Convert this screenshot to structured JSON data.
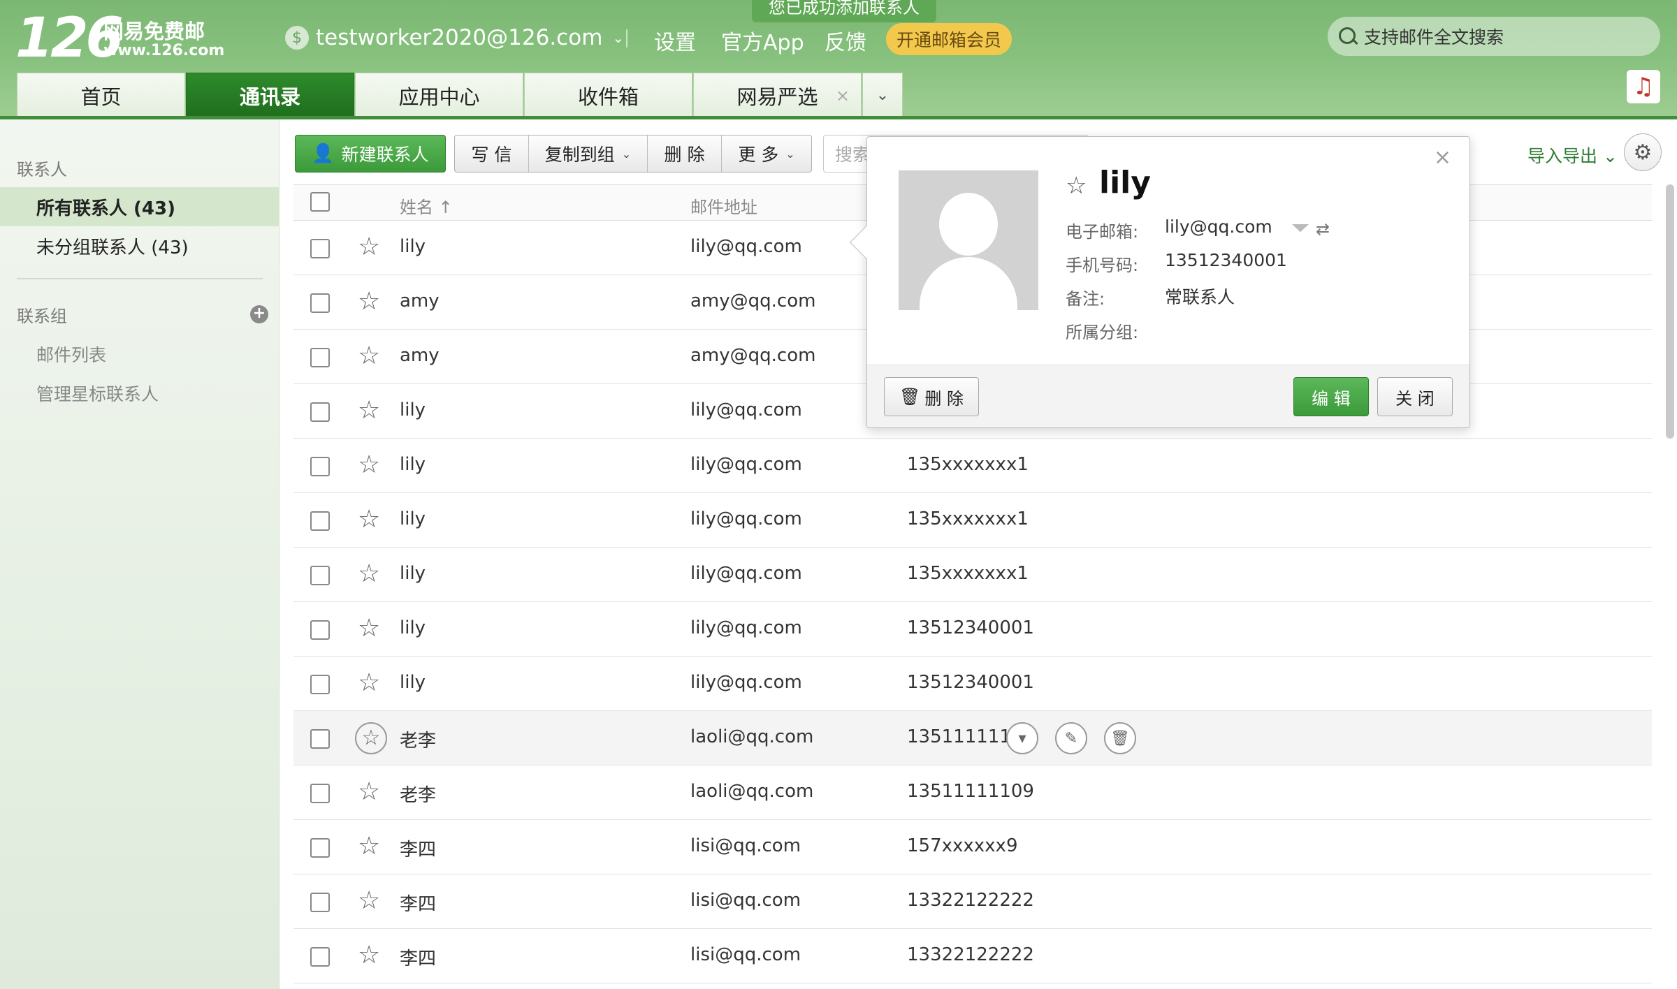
{
  "brand": {
    "logo_number": "126",
    "name": "网易免费邮",
    "url": "www.126.com"
  },
  "header": {
    "account": "testworker2020@126.com",
    "links": [
      "设置",
      "官方App",
      "反馈"
    ],
    "vip_button": "开通邮箱会员",
    "toast": "您已成功添加联系人",
    "search_placeholder": "支持邮件全文搜索"
  },
  "tabs": [
    {
      "label": "首页"
    },
    {
      "label": "通讯录"
    },
    {
      "label": "应用中心"
    },
    {
      "label": "收件箱"
    },
    {
      "label": "网易严选"
    }
  ],
  "sidebar": {
    "contacts_heading": "联系人",
    "items": [
      "所有联系人 (43)",
      "未分组联系人 (43)"
    ],
    "groups_heading": "联系组",
    "group_items": [
      "邮件列表",
      "管理星标联系人"
    ]
  },
  "toolbar": {
    "new_contact": "新建联系人",
    "write": "写 信",
    "copy_to_group": "复制到组",
    "delete": "删 除",
    "more": "更 多",
    "search_placeholder": "搜索",
    "import_export": "导入导出"
  },
  "table": {
    "columns": {
      "name": "姓名",
      "email": "邮件地址"
    },
    "rows": [
      {
        "name": "lily",
        "email": "lily@qq.com",
        "phone": ""
      },
      {
        "name": "amy",
        "email": "amy@qq.com",
        "phone": ""
      },
      {
        "name": "amy",
        "email": "amy@qq.com",
        "phone": ""
      },
      {
        "name": "lily",
        "email": "lily@qq.com",
        "phone": ""
      },
      {
        "name": "lily",
        "email": "lily@qq.com",
        "phone": "135xxxxxxx1"
      },
      {
        "name": "lily",
        "email": "lily@qq.com",
        "phone": "135xxxxxxx1"
      },
      {
        "name": "lily",
        "email": "lily@qq.com",
        "phone": "135xxxxxxx1"
      },
      {
        "name": "lily",
        "email": "lily@qq.com",
        "phone": "13512340001"
      },
      {
        "name": "lily",
        "email": "lily@qq.com",
        "phone": "13512340001"
      },
      {
        "name": "老李",
        "email": "laoli@qq.com",
        "phone": "13511111109"
      },
      {
        "name": "老李",
        "email": "laoli@qq.com",
        "phone": "13511111109"
      },
      {
        "name": "李四",
        "email": "lisi@qq.com",
        "phone": "157xxxxxx9"
      },
      {
        "name": "李四",
        "email": "lisi@qq.com",
        "phone": "13322122222"
      },
      {
        "name": "李四",
        "email": "lisi@qq.com",
        "phone": "13322122222"
      }
    ]
  },
  "popup": {
    "name": "lily",
    "email_label": "电子邮箱:",
    "email": "lily@qq.com",
    "phone_label": "手机号码:",
    "phone": "13512340001",
    "note_label": "备注:",
    "note": "常联系人",
    "group_label": "所属分组:",
    "delete": "删 除",
    "edit": "编 辑",
    "close": "关 闭"
  },
  "colors": {
    "brand_green": "#3b9a39",
    "vip_yellow": "#f2c94c",
    "header_green": "#86c07d"
  }
}
